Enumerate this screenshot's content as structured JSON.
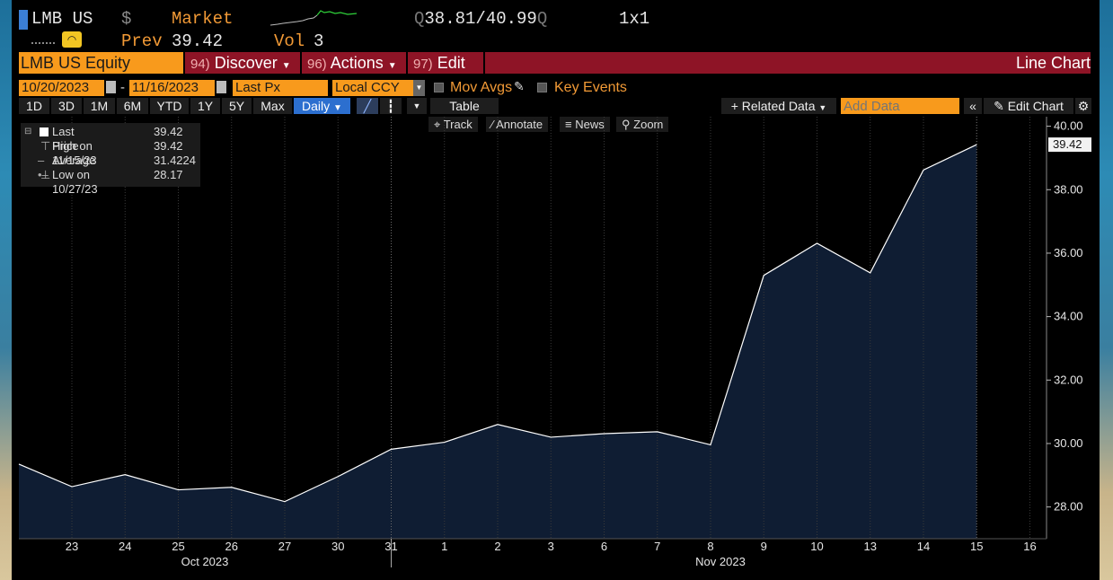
{
  "header": {
    "ticker": "LMB US",
    "currency_symbol": "$",
    "market_label": "Market",
    "bid_ask_prefix": "Q",
    "bid": "38.81",
    "bid_ask_sep": "/",
    "ask": "40.99",
    "ask_suffix": "Q",
    "size": "1x1",
    "prev_label": "Prev",
    "prev_value": "39.42",
    "vol_label": "Vol",
    "vol_value": "3"
  },
  "menu": {
    "security": "LMB US Equity",
    "discover_num": "94)",
    "discover": "Discover",
    "actions_num": "96)",
    "actions": "Actions",
    "edit_num": "97)",
    "edit": "Edit",
    "title": "Line Chart"
  },
  "settings": {
    "start_date": "10/20/2023",
    "date_sep": "-",
    "end_date": "11/16/2023",
    "field": "Last Px",
    "currency": "Local CCY",
    "mov_avgs": "Mov Avgs",
    "key_events": "Key Events"
  },
  "toolbar": {
    "ranges": [
      "1D",
      "3D",
      "1M",
      "6M",
      "YTD",
      "1Y",
      "5Y",
      "Max"
    ],
    "frequency": "Daily",
    "table": "Table",
    "related_data": "Related Data",
    "add_data_placeholder": "Add Data",
    "edit_chart": "Edit Chart"
  },
  "subtoolbar": {
    "track": "Track",
    "annotate": "Annotate",
    "news": "News",
    "zoom": "Zoom"
  },
  "legend": {
    "last_price_label": "Last Price",
    "last_price_value": "39.42",
    "high_label": "High on 11/15/23",
    "high_value": "39.42",
    "average_label": "Average",
    "average_value": "31.4224",
    "low_label": "Low on 10/27/23",
    "low_value": "28.17"
  },
  "colors": {
    "accent_orange": "#f89a1c",
    "menu_red": "#8e1426",
    "area_fill": "#0f1d33",
    "line": "#ffffff"
  },
  "chart_data": {
    "type": "area",
    "x": [
      "23",
      "24",
      "25",
      "26",
      "27",
      "30",
      "31",
      "1",
      "2",
      "3",
      "6",
      "7",
      "8",
      "9",
      "10",
      "13",
      "14",
      "15"
    ],
    "values": [
      28.64,
      29.02,
      28.54,
      28.62,
      28.17,
      28.96,
      29.82,
      30.04,
      30.6,
      30.2,
      30.31,
      30.37,
      29.96,
      35.3,
      36.31,
      35.38,
      38.62,
      39.42
    ],
    "start_value": 29.35,
    "extra_tick": "16",
    "month_labels": [
      "Oct 2023",
      "Nov 2023"
    ],
    "y_ticks": [
      "28.00",
      "30.00",
      "32.00",
      "34.00",
      "36.00",
      "38.00",
      "40.00"
    ],
    "ylim": [
      27.0,
      40.3
    ],
    "last_value_label": "39.42",
    "grid": "vertical dotted"
  }
}
